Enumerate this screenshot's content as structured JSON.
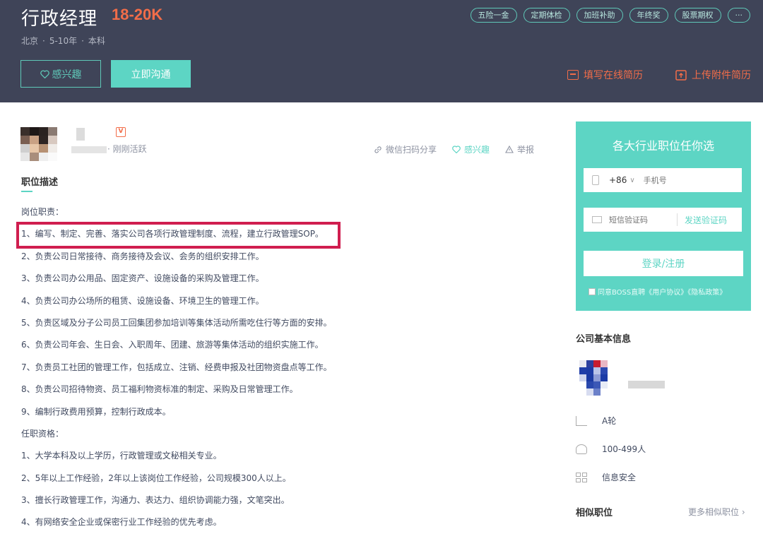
{
  "header": {
    "job_title": "行政经理",
    "salary": "18-20K",
    "meta": [
      "北京",
      "5-10年",
      "本科"
    ],
    "meta_separator": "·",
    "tags": [
      "五险一金",
      "定期体检",
      "加班补助",
      "年终奖",
      "股票期权",
      "···"
    ],
    "interest_label": "感兴趣",
    "chat_label": "立即沟通",
    "resume_online": "填写在线简历",
    "resume_upload": "上传附件简历"
  },
  "recruiter": {
    "verified_mark": "V",
    "active_status": "刚刚活跃",
    "status_separator": "·",
    "actions": {
      "share": "微信扫码分享",
      "interest": "感兴趣",
      "report": "举报"
    }
  },
  "description": {
    "title": "职位描述",
    "responsibilities_heading": "岗位职责：",
    "responsibilities": [
      "1、编写、制定、完善、落实公司各项行政管理制度、流程，建立行政管理SOP。",
      "2、负责公司日常接待、商务接待及会议、会务的组织安排工作。",
      "3、负责公司办公用品、固定资产、设施设备的采购及管理工作。",
      "4、负责公司办公场所的租赁、设施设备、环境卫生的管理工作。",
      "5、负责区域及分子公司员工回集团参加培训等集体活动所需吃住行等方面的安排。",
      "6、负责公司年会、生日会、入职周年、团建、旅游等集体活动的组织实施工作。",
      "7、负责员工社团的管理工作，包括成立、注销、经费申报及社团物资盘点等工作。",
      "8、负责公司招待物资、员工福利物资标准的制定、采购及日常管理工作。",
      "9、编制行政费用预算，控制行政成本。"
    ],
    "requirements_heading": "任职资格：",
    "requirements": [
      "1、大学本科及以上学历，行政管理或文秘相关专业。",
      "2、5年以上工作经验，2年以上该岗位工作经验，公司规模300人以上。",
      "3、擅长行政管理工作，沟通力、表达力、组织协调能力强，文笔突出。",
      "4、有网络安全企业或保密行业工作经验的优先考虑。"
    ]
  },
  "signup": {
    "title": "各大行业职位任你选",
    "country_code": "+86",
    "phone_placeholder": "手机号",
    "code_placeholder": "短信验证码",
    "send_code": "发送验证码",
    "login_label": "登录/注册",
    "agreement": "同意BOSS直聘《用户协议》《隐私政策》"
  },
  "company": {
    "title": "公司基本信息",
    "funding": "A轮",
    "size": "100-499人",
    "industry": "信息安全"
  },
  "similar": {
    "title": "相似职位",
    "more": "更多相似职位"
  },
  "colors": {
    "header_bg": "#3f4458",
    "accent": "#5dd5c4",
    "salary": "#f26d49",
    "highlight": "#d01e4f"
  }
}
